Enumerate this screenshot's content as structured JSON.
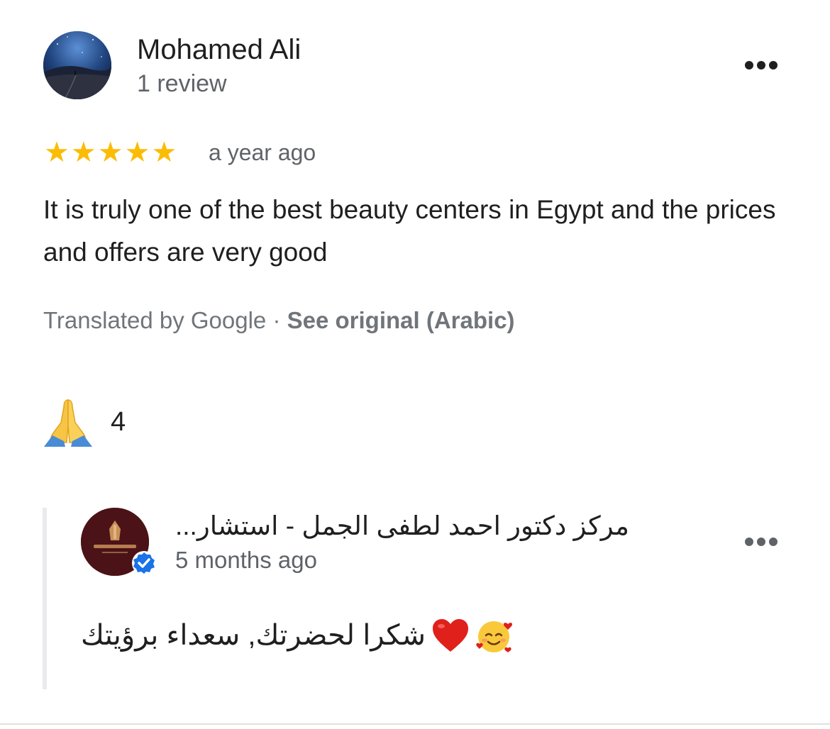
{
  "reviewer": {
    "name": "Mohamed Ali",
    "review_count": "1 review"
  },
  "review": {
    "rating": 5,
    "stars": [
      "★",
      "★",
      "★",
      "★",
      "★"
    ],
    "time": "a year ago",
    "text": "It is truly one of the best beauty centers in Egypt and the prices and offers are very good",
    "translated_by": "Translated by Google · ",
    "see_original": "See original (Arabic)"
  },
  "reaction": {
    "icon": "folded-hands-icon",
    "count": "4"
  },
  "owner_reply": {
    "name": "مركز دكتور احمد لطفى الجمل - استشار...",
    "time": "5 months ago",
    "text": "شكرا لحضرتك, سعداء برؤيتك",
    "emojis": [
      "heart-icon",
      "smiling-face-with-hearts-icon"
    ],
    "verified": true
  },
  "colors": {
    "star": "#fbbc04",
    "primary_text": "#1f1f1f",
    "secondary_text": "#5f6368",
    "verified_badge": "#1a73e8",
    "heart": "#e0201b"
  }
}
